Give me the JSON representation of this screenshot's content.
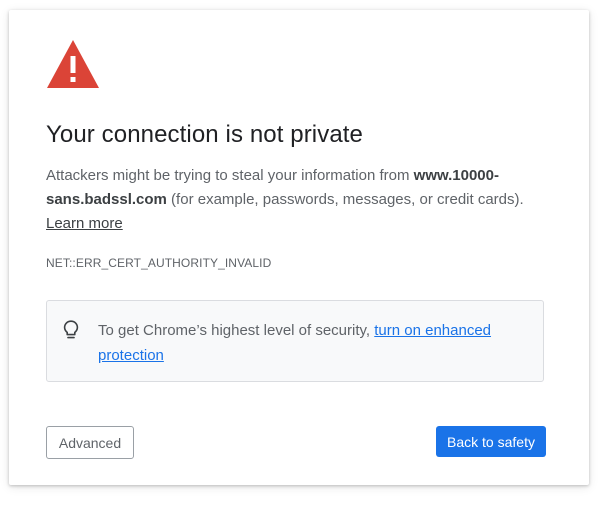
{
  "colors": {
    "warning_icon": "#db4437",
    "title_text": "#202124",
    "body_text": "#5f6368",
    "link_blue": "#1a73e8",
    "primary_button": "#1a73e8",
    "tip_background": "#f8f9fa"
  },
  "icons": {
    "warning": "warning-triangle-icon",
    "tip": "lightbulb-icon"
  },
  "interstitial": {
    "title": "Your connection is not private",
    "description_prefix": "Attackers might be trying to steal your information from ",
    "host": "www.10000-sans.badssl.com",
    "description_suffix": " (for example, passwords, messages, or credit cards). ",
    "learn_more": "Learn more",
    "error_code": "NET::ERR_CERT_AUTHORITY_INVALID"
  },
  "tip": {
    "text": "To get Chrome’s highest level of security, ",
    "link": "turn on enhanced protection"
  },
  "buttons": {
    "advanced": "Advanced",
    "back_to_safety": "Back to safety"
  }
}
